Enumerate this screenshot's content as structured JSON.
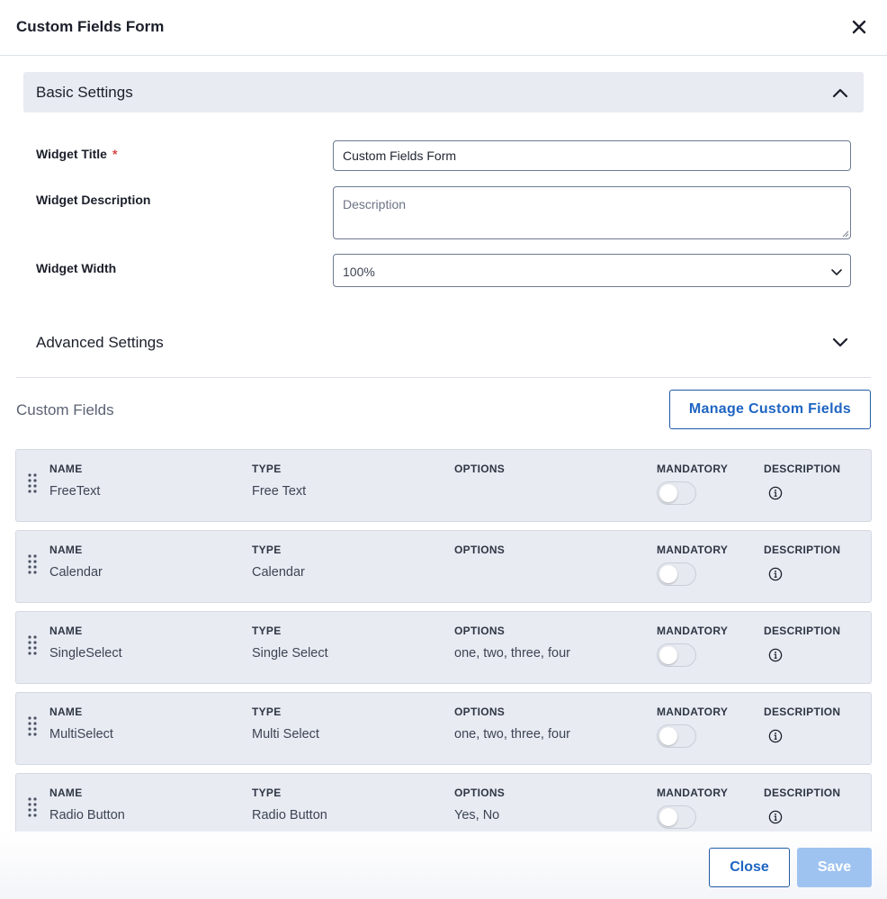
{
  "modal": {
    "title": "Custom Fields Form"
  },
  "basic_settings": {
    "section_label": "Basic Settings",
    "widget_title_label": "Widget Title",
    "required_mark": "*",
    "widget_title_value": "Custom Fields Form",
    "widget_description_label": "Widget Description",
    "widget_description_placeholder": "Description",
    "widget_width_label": "Widget Width",
    "widget_width_value": "100%"
  },
  "advanced_settings": {
    "section_label": "Advanced Settings"
  },
  "custom_fields": {
    "title": "Custom Fields",
    "manage_button": "Manage Custom Fields",
    "headers": {
      "name": "NAME",
      "type": "TYPE",
      "options": "OPTIONS",
      "mandatory": "MANDATORY",
      "description": "DESCRIPTION"
    },
    "rows": [
      {
        "name": "FreeText",
        "type": "Free Text",
        "options": "",
        "mandatory": false
      },
      {
        "name": "Calendar",
        "type": "Calendar",
        "options": "",
        "mandatory": false
      },
      {
        "name": "SingleSelect",
        "type": "Single Select",
        "options": "one, two, three, four",
        "mandatory": false
      },
      {
        "name": "MultiSelect",
        "type": "Multi Select",
        "options": "one, two, three, four",
        "mandatory": false
      },
      {
        "name": "Radio Button",
        "type": "Radio Button",
        "options": "Yes, No",
        "mandatory": false
      }
    ]
  },
  "footer": {
    "close_label": "Close",
    "save_label": "Save"
  },
  "colors": {
    "accent": "#1f65c2",
    "panel": "#e8ebf2",
    "save_disabled": "#9fc3f1",
    "required": "#d64545"
  }
}
